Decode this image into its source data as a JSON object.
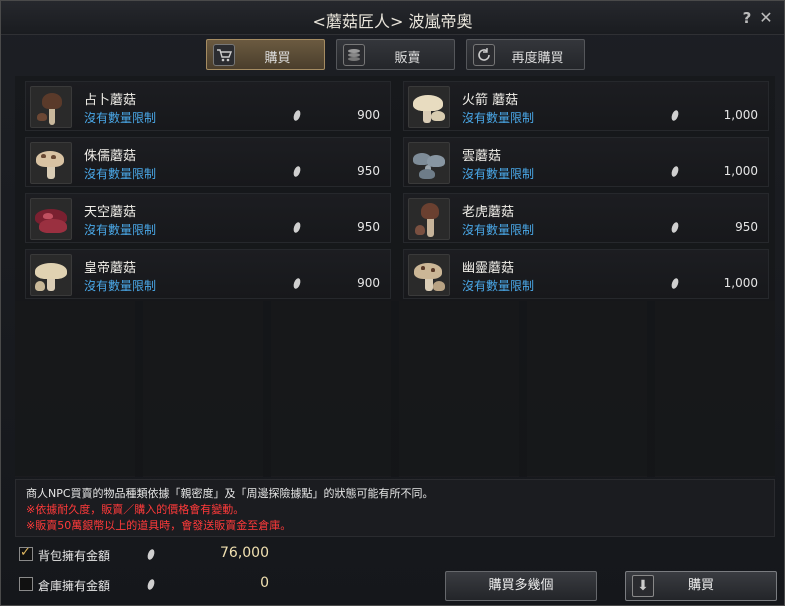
{
  "window": {
    "title": "<蘑菇匠人> 波嵐帝奧"
  },
  "controls": {
    "help": "?",
    "close": "✕"
  },
  "tabs": [
    {
      "label": "購買",
      "icon": "cart-icon",
      "active": true
    },
    {
      "label": "販賣",
      "icon": "coins-icon",
      "active": false
    },
    {
      "label": "再度購買",
      "icon": "refresh-icon",
      "active": false
    }
  ],
  "items": [
    {
      "name": "占卜蘑菇",
      "limit": "沒有數量限制",
      "price": "900"
    },
    {
      "name": "火箭 蘑菇",
      "limit": "沒有數量限制",
      "price": "1,000"
    },
    {
      "name": "侏儒蘑菇",
      "limit": "沒有數量限制",
      "price": "950"
    },
    {
      "name": "雲蘑菇",
      "limit": "沒有數量限制",
      "price": "1,000"
    },
    {
      "name": "天空蘑菇",
      "limit": "沒有數量限制",
      "price": "950"
    },
    {
      "name": "老虎蘑菇",
      "limit": "沒有數量限制",
      "price": "950"
    },
    {
      "name": "皇帝蘑菇",
      "limit": "沒有數量限制",
      "price": "900"
    },
    {
      "name": "幽靈蘑菇",
      "limit": "沒有數量限制",
      "price": "1,000"
    }
  ],
  "notes": [
    "商人NPC買賣的物品種類依據「親密度」及「周邊探險據點」的狀態可能有所不同。",
    "※依據耐久度，販賣／購入的價格會有變動。",
    "※販賣50萬銀幣以上的道具時，會發送販賣金至倉庫。"
  ],
  "money": {
    "inventory": {
      "label": "背包擁有金額",
      "value": "76,000",
      "checked": true
    },
    "storage": {
      "label": "倉庫擁有金額",
      "value": "0",
      "checked": false
    }
  },
  "buttons": {
    "buy_multiple": "購買多幾個",
    "buy": "購買"
  },
  "colors": {
    "limit_text": "#4aa8e8",
    "warning_text": "#ff3a3a",
    "active_tab": "#6b5a40"
  }
}
